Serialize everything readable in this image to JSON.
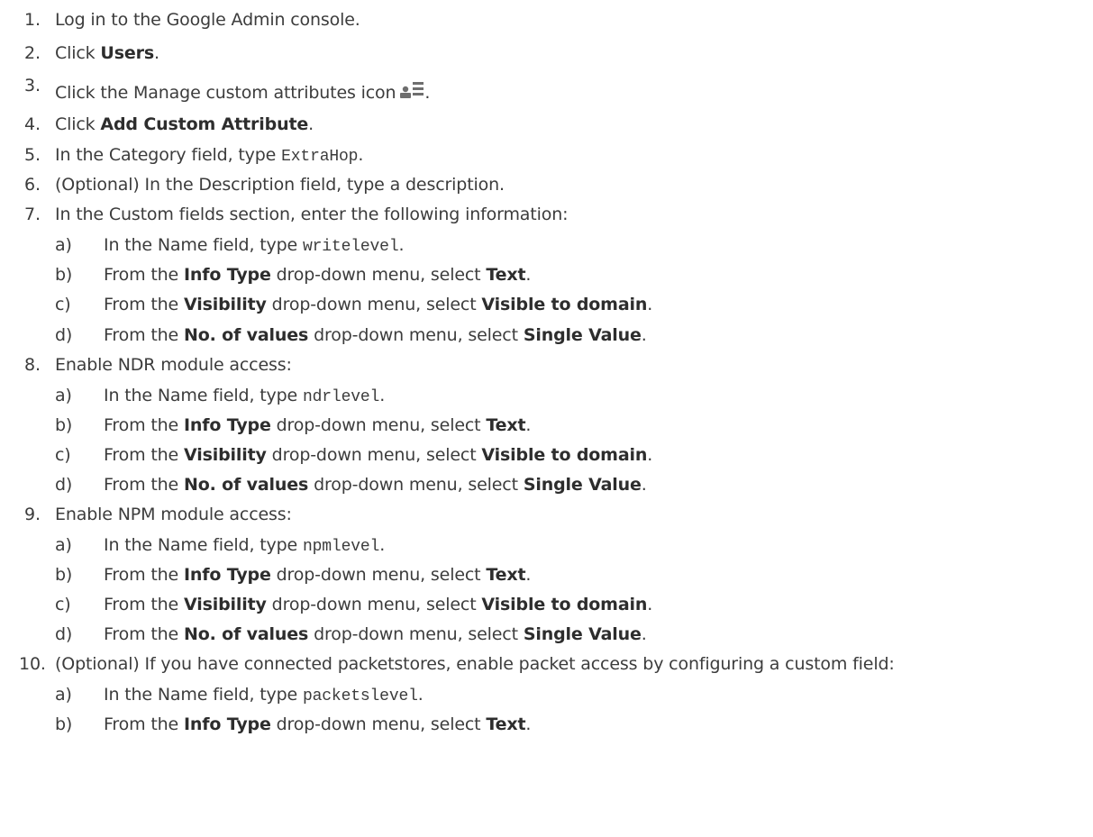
{
  "steps": [
    {
      "n": "1.",
      "parts": [
        {
          "t": "Log in to the Google Admin console."
        }
      ]
    },
    {
      "n": "2.",
      "parts": [
        {
          "t": "Click "
        },
        {
          "b": "Users"
        },
        {
          "t": "."
        }
      ]
    },
    {
      "n": "3.",
      "parts": [
        {
          "t": "Click the Manage custom attributes icon"
        },
        {
          "icon": "manage-custom-attributes-icon"
        },
        {
          "t": "."
        }
      ]
    },
    {
      "n": "4.",
      "parts": [
        {
          "t": "Click "
        },
        {
          "b": "Add Custom Attribute"
        },
        {
          "t": "."
        }
      ]
    },
    {
      "n": "5.",
      "parts": [
        {
          "t": "In the Category field, type "
        },
        {
          "c": "ExtraHop"
        },
        {
          "t": "."
        }
      ]
    },
    {
      "n": "6.",
      "parts": [
        {
          "t": "(Optional) In the Description field, type a description."
        }
      ]
    },
    {
      "n": "7.",
      "parts": [
        {
          "t": "In the Custom fields section, enter the following information:"
        }
      ],
      "subs": [
        {
          "n": "a)",
          "parts": [
            {
              "t": "In the Name field, type "
            },
            {
              "c": "writelevel"
            },
            {
              "t": "."
            }
          ]
        },
        {
          "n": "b)",
          "parts": [
            {
              "t": "From the "
            },
            {
              "b": "Info Type"
            },
            {
              "t": " drop-down menu, select "
            },
            {
              "b": "Text"
            },
            {
              "t": "."
            }
          ]
        },
        {
          "n": "c)",
          "parts": [
            {
              "t": "From the "
            },
            {
              "b": "Visibility"
            },
            {
              "t": " drop-down menu, select "
            },
            {
              "b": "Visible to domain"
            },
            {
              "t": "."
            }
          ]
        },
        {
          "n": "d)",
          "parts": [
            {
              "t": "From the "
            },
            {
              "b": "No. of values"
            },
            {
              "t": " drop-down menu, select "
            },
            {
              "b": "Single Value"
            },
            {
              "t": "."
            }
          ]
        }
      ]
    },
    {
      "n": "8.",
      "parts": [
        {
          "t": "Enable NDR module access:"
        }
      ],
      "subs": [
        {
          "n": "a)",
          "parts": [
            {
              "t": "In the Name field, type "
            },
            {
              "c": "ndrlevel"
            },
            {
              "t": "."
            }
          ]
        },
        {
          "n": "b)",
          "parts": [
            {
              "t": "From the "
            },
            {
              "b": "Info Type"
            },
            {
              "t": " drop-down menu, select "
            },
            {
              "b": "Text"
            },
            {
              "t": "."
            }
          ]
        },
        {
          "n": "c)",
          "parts": [
            {
              "t": "From the "
            },
            {
              "b": "Visibility"
            },
            {
              "t": " drop-down menu, select "
            },
            {
              "b": "Visible to domain"
            },
            {
              "t": "."
            }
          ]
        },
        {
          "n": "d)",
          "parts": [
            {
              "t": "From the "
            },
            {
              "b": "No. of values"
            },
            {
              "t": " drop-down menu, select "
            },
            {
              "b": "Single Value"
            },
            {
              "t": "."
            }
          ]
        }
      ]
    },
    {
      "n": "9.",
      "parts": [
        {
          "t": "Enable NPM module access:"
        }
      ],
      "subs": [
        {
          "n": "a)",
          "parts": [
            {
              "t": "In the Name field, type "
            },
            {
              "c": "npmlevel"
            },
            {
              "t": "."
            }
          ]
        },
        {
          "n": "b)",
          "parts": [
            {
              "t": "From the "
            },
            {
              "b": "Info Type"
            },
            {
              "t": " drop-down menu, select "
            },
            {
              "b": "Text"
            },
            {
              "t": "."
            }
          ]
        },
        {
          "n": "c)",
          "parts": [
            {
              "t": "From the "
            },
            {
              "b": "Visibility"
            },
            {
              "t": " drop-down menu, select "
            },
            {
              "b": "Visible to domain"
            },
            {
              "t": "."
            }
          ]
        },
        {
          "n": "d)",
          "parts": [
            {
              "t": "From the "
            },
            {
              "b": "No. of values"
            },
            {
              "t": " drop-down menu, select "
            },
            {
              "b": "Single Value"
            },
            {
              "t": "."
            }
          ]
        }
      ]
    },
    {
      "n": "10.",
      "parts": [
        {
          "t": "(Optional) If you have connected packetstores, enable packet access by configuring a custom field:"
        }
      ],
      "subs": [
        {
          "n": "a)",
          "parts": [
            {
              "t": "In the Name field, type "
            },
            {
              "c": "packetslevel"
            },
            {
              "t": "."
            }
          ]
        },
        {
          "n": "b)",
          "parts": [
            {
              "t": "From the "
            },
            {
              "b": "Info Type"
            },
            {
              "t": " drop-down menu, select "
            },
            {
              "b": "Text"
            },
            {
              "t": "."
            }
          ]
        }
      ]
    }
  ]
}
